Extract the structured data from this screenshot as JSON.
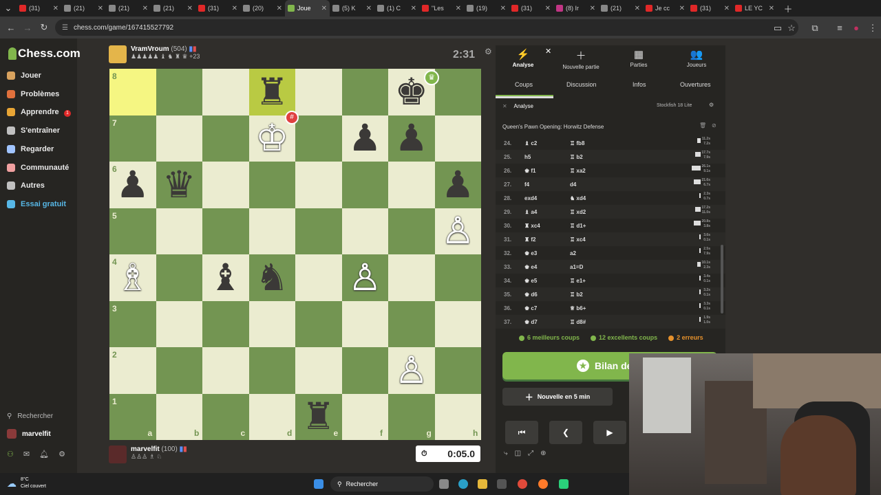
{
  "browser": {
    "tabs": [
      {
        "label": "(31)",
        "color": "#e02828",
        "active": false
      },
      {
        "label": "(21)",
        "color": "#888888",
        "active": false
      },
      {
        "label": "(21)",
        "color": "#888888",
        "active": false
      },
      {
        "label": "(21)",
        "color": "#888888",
        "active": false
      },
      {
        "label": "(31)",
        "color": "#e02828",
        "active": false
      },
      {
        "label": "(20)",
        "color": "#888888",
        "active": false
      },
      {
        "label": "Joue",
        "color": "#81b64c",
        "active": true
      },
      {
        "label": "(5) K",
        "color": "#888888",
        "active": false
      },
      {
        "label": "(1) C",
        "color": "#888888",
        "active": false
      },
      {
        "label": "\"Les",
        "color": "#e02828",
        "active": false
      },
      {
        "label": "(19)",
        "color": "#888888",
        "active": false
      },
      {
        "label": "(31)",
        "color": "#e02828",
        "active": false
      },
      {
        "label": "(8) Ir",
        "color": "#c13584",
        "active": false
      },
      {
        "label": "(21)",
        "color": "#888888",
        "active": false
      },
      {
        "label": "Je cc",
        "color": "#e02828",
        "active": false
      },
      {
        "label": "(31)",
        "color": "#e02828",
        "active": false
      },
      {
        "label": "LE YC",
        "color": "#e02828",
        "active": false
      }
    ],
    "url": "chess.com/game/167415527792"
  },
  "nav": {
    "logo": "Chess.com",
    "items": [
      {
        "label": "Jouer",
        "color": "#d8a25e"
      },
      {
        "label": "Problèmes",
        "color": "#e0703c"
      },
      {
        "label": "Apprendre",
        "color": "#e8a535"
      },
      {
        "label": "S'entraîner",
        "color": "#c0c0c0"
      },
      {
        "label": "Regarder",
        "color": "#a0c4ff"
      },
      {
        "label": "Communauté",
        "color": "#f0a0a0"
      },
      {
        "label": "Autres",
        "color": "#c0c0c0"
      },
      {
        "label": "Essai gratuit",
        "color": "#57b7e6"
      }
    ],
    "jouer_badge": "1",
    "search": "Rechercher",
    "user": "marvelfit"
  },
  "top_player": {
    "name": "VramVroum",
    "rating": "(504)",
    "material": "+23",
    "clock": "2:31"
  },
  "bottom_player": {
    "name": "marvelfit",
    "rating": "(100)",
    "clock": "0:05.0"
  },
  "board": {
    "files": [
      "a",
      "b",
      "c",
      "d",
      "e",
      "f",
      "g",
      "h"
    ],
    "ranks": [
      "8",
      "7",
      "6",
      "5",
      "4",
      "3",
      "2",
      "1"
    ],
    "pieces": [
      {
        "square": "d8",
        "glyph": "♜",
        "color": "black"
      },
      {
        "square": "g8",
        "glyph": "♚",
        "color": "black"
      },
      {
        "square": "d7",
        "glyph": "♔",
        "color": "white"
      },
      {
        "square": "f7",
        "glyph": "♟",
        "color": "black"
      },
      {
        "square": "g7",
        "glyph": "♟",
        "color": "black"
      },
      {
        "square": "a6",
        "glyph": "♟",
        "color": "black"
      },
      {
        "square": "b6",
        "glyph": "♛",
        "color": "black"
      },
      {
        "square": "h6",
        "glyph": "♟",
        "color": "black"
      },
      {
        "square": "h5",
        "glyph": "♙",
        "color": "white"
      },
      {
        "square": "a4",
        "glyph": "♗",
        "color": "white"
      },
      {
        "square": "c4",
        "glyph": "♝",
        "color": "black"
      },
      {
        "square": "d4",
        "glyph": "♞",
        "color": "black"
      },
      {
        "square": "f4",
        "glyph": "♙",
        "color": "white"
      },
      {
        "square": "g2",
        "glyph": "♙",
        "color": "white"
      },
      {
        "square": "e1",
        "glyph": "♜",
        "color": "black"
      }
    ],
    "highlight_last": [
      "a8"
    ],
    "highlight_move": [
      "d8"
    ]
  },
  "panel": {
    "tabs": [
      {
        "label": "Analyse",
        "icon": "⚡"
      },
      {
        "label": "Nouvelle partie",
        "icon": "＋"
      },
      {
        "label": "Parties",
        "icon": "▦"
      },
      {
        "label": "Joueurs",
        "icon": "👥"
      }
    ],
    "subtabs": [
      "Coups",
      "Discussion",
      "Infos",
      "Ouvertures"
    ],
    "analysis_label": "Analyse",
    "engine": "Stockfish 18 Lite",
    "opening": "Queen's Pawn Opening: Horwitz Defense",
    "moves": [
      {
        "n": "24.",
        "w": "♝ c2",
        "b": "♖ fb8",
        "bar": 0.3,
        "t1": "11.2s",
        "t2": "7.2s"
      },
      {
        "n": "25.",
        "w": "h5",
        "b": "♖ b2",
        "bar": 0.5,
        "t1": "17.7s",
        "t2": "7.9s"
      },
      {
        "n": "26.",
        "w": "♚ f1",
        "b": "♖ xa2",
        "bar": 0.8,
        "t1": "26.1s",
        "t2": "9.1s"
      },
      {
        "n": "27.",
        "w": "f4",
        "b": "d4",
        "bar": 0.6,
        "t1": "21.6s",
        "t2": "6.7s"
      },
      {
        "n": "28.",
        "w": "exd4",
        "b": "♞ xd4",
        "bar": 0.1,
        "t1": "2.3s",
        "t2": "0.7s"
      },
      {
        "n": "29.",
        "w": "♝ a4",
        "b": "♖ xd2",
        "bar": 0.5,
        "t1": "17.2s",
        "t2": "11.0s"
      },
      {
        "n": "30.",
        "w": "♜ xc4",
        "b": "♖ d1+",
        "bar": 0.6,
        "t1": "20.8s",
        "t2": "3.8s"
      },
      {
        "n": "31.",
        "w": "♜ f2",
        "b": "♖ xc4",
        "bar": 0.1,
        "t1": "3.6s",
        "t2": "0.1s"
      },
      {
        "n": "32.",
        "w": "♚ e3",
        "b": "a2",
        "bar": 0.1,
        "t1": "2.5s",
        "t2": "7.9s"
      },
      {
        "n": "33.",
        "w": "♚ e4",
        "b": "a1=D",
        "bar": 0.3,
        "t1": "10.1s",
        "t2": "2.3s"
      },
      {
        "n": "34.",
        "w": "♚ e5",
        "b": "♖ e1+",
        "bar": 0.1,
        "t1": "3.4s",
        "t2": "0.1s"
      },
      {
        "n": "35.",
        "w": "♚ d6",
        "b": "♖ b2",
        "bar": 0.1,
        "t1": "3.2s",
        "t2": "0.1s"
      },
      {
        "n": "36.",
        "w": "♚ c7",
        "b": "♕ b6+",
        "bar": 0.1,
        "t1": "3.3s",
        "t2": "0.1s"
      },
      {
        "n": "37.",
        "w": "♚ d7",
        "b": "♖ d8#",
        "bar": 0.05,
        "t1": "1.9s",
        "t2": "1.0s"
      }
    ],
    "summary": [
      {
        "label": "6 meilleurs coups",
        "color": "#81b64c"
      },
      {
        "label": "12 excellents coups",
        "color": "#81b64c"
      },
      {
        "label": "2 erreurs",
        "color": "#e6912c"
      }
    ],
    "review_button": "Bilan de la",
    "new_game_button": "Nouvelle en 5 min"
  },
  "taskbar": {
    "weather_temp": "8°C",
    "weather_desc": "Ciel couvert",
    "search": "Rechercher"
  }
}
